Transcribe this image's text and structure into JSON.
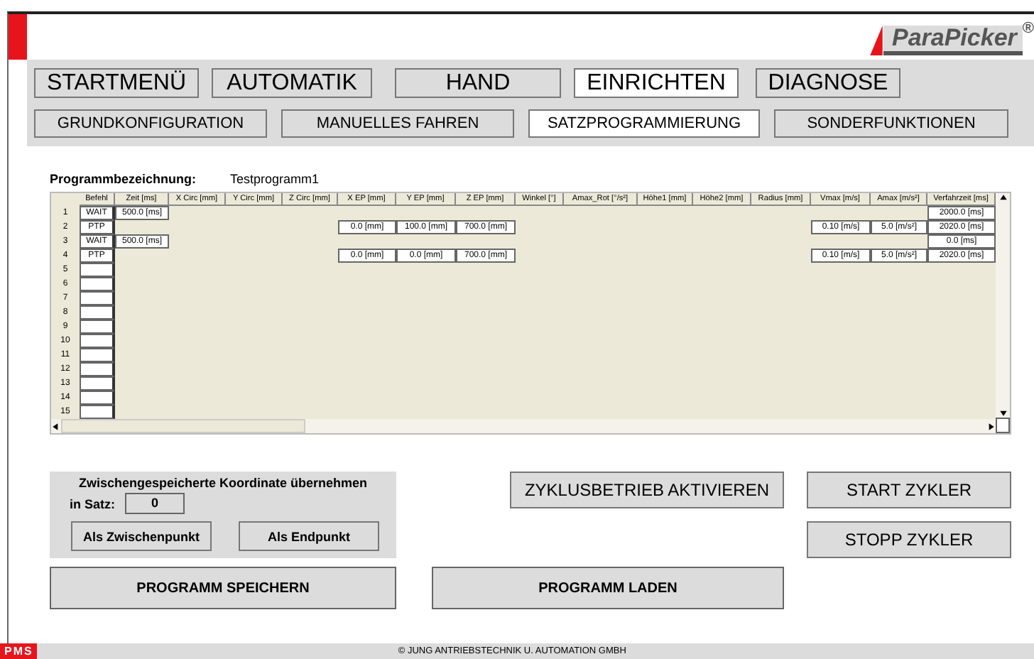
{
  "logo": {
    "brand": "ParaPicker",
    "mark": "®"
  },
  "main_nav": [
    {
      "label": "STARTMENÜ",
      "selected": false
    },
    {
      "label": "AUTOMATIK",
      "selected": false
    },
    {
      "label": "HAND",
      "selected": false
    },
    {
      "label": "EINRICHTEN",
      "selected": true
    },
    {
      "label": "DIAGNOSE",
      "selected": false
    }
  ],
  "sub_nav": [
    {
      "label": "GRUNDKONFIGURATION",
      "selected": false
    },
    {
      "label": "MANUELLES FAHREN",
      "selected": false
    },
    {
      "label": "SATZPROGRAMMIERUNG",
      "selected": true
    },
    {
      "label": "SONDERFUNKTIONEN",
      "selected": false
    }
  ],
  "program": {
    "label": "Programmbezeichnung:",
    "value": "Testprogramm1"
  },
  "table": {
    "columns": [
      "Befehl",
      "Zeit [ms]",
      "X Circ [mm]",
      "Y Circ [mm]",
      "Z Circ [mm]",
      "X EP [mm]",
      "Y EP [mm]",
      "Z EP [mm]",
      "Winkel [°]",
      "Amax_Rot [°/s²]",
      "Höhe1 [mm]",
      "Höhe2 [mm]",
      "Radius [mm]",
      "Vmax [m/s]",
      "Amax [m/s²]",
      "Verfahrzeit [ms]"
    ],
    "rows": [
      {
        "number": "1",
        "cells": [
          "WAIT",
          "500.0 [ms]",
          null,
          null,
          null,
          null,
          null,
          null,
          null,
          null,
          null,
          null,
          null,
          null,
          null,
          "2000.0 [ms]"
        ]
      },
      {
        "number": "2",
        "cells": [
          "PTP",
          null,
          null,
          null,
          null,
          "0.0 [mm]",
          "100.0 [mm]",
          "700.0 [mm]",
          null,
          null,
          null,
          null,
          null,
          "0.10 [m/s]",
          "5.0 [m/s²]",
          "2020.0 [ms]"
        ]
      },
      {
        "number": "3",
        "cells": [
          "WAIT",
          "500.0 [ms]",
          null,
          null,
          null,
          null,
          null,
          null,
          null,
          null,
          null,
          null,
          null,
          null,
          null,
          "0.0 [ms]"
        ]
      },
      {
        "number": "4",
        "cells": [
          "PTP",
          null,
          null,
          null,
          null,
          "0.0 [mm]",
          "0.0 [mm]",
          "700.0 [mm]",
          null,
          null,
          null,
          null,
          null,
          "0.10 [m/s]",
          "5.0 [m/s²]",
          "2020.0 [ms]"
        ]
      },
      {
        "number": "5"
      },
      {
        "number": "6"
      },
      {
        "number": "7"
      },
      {
        "number": "8"
      },
      {
        "number": "9"
      },
      {
        "number": "10"
      },
      {
        "number": "11"
      },
      {
        "number": "12"
      },
      {
        "number": "13"
      },
      {
        "number": "14"
      },
      {
        "number": "15"
      }
    ]
  },
  "coordinate_panel": {
    "title": "Zwischengespeicherte Koordinate übernehmen",
    "satz_label": "in Satz:",
    "satz_value": "0",
    "buttons": [
      "Als Zwischenpunkt",
      "Als Endpunkt"
    ]
  },
  "cycle_buttons": {
    "activate": "ZYKLUSBETRIEB AKTIVIEREN",
    "start": "START ZYKLER",
    "stop": "STOPP ZYKLER"
  },
  "program_buttons": {
    "save": "PROGRAMM SPEICHERN",
    "load": "PROGRAMM LADEN"
  },
  "footer": {
    "badge": "PMS",
    "copyright": "© JUNG ANTRIEBSTECHNIK U. AUTOMATION GMBH"
  }
}
